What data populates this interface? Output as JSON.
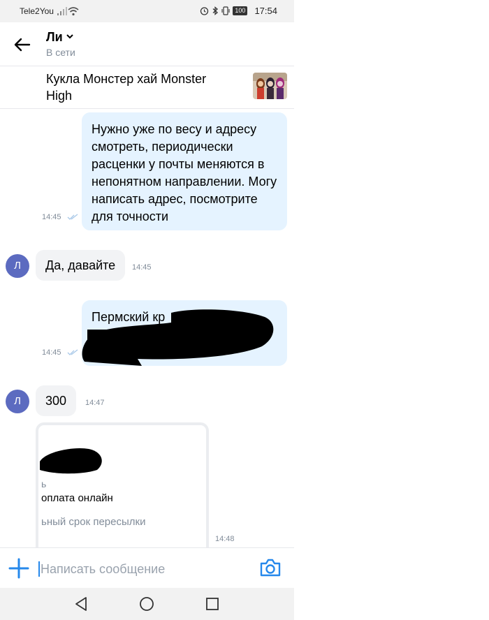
{
  "status_bar": {
    "carrier": "Tele2You",
    "battery": "100",
    "time": "17:54"
  },
  "header": {
    "contact_name": "Ли",
    "status": "В сети"
  },
  "product": {
    "title": "Кукла Монстер хай Monster High"
  },
  "messages": [
    {
      "direction": "out",
      "text": "Нужно уже по весу и адресу смотреть, периодически расценки у почты меняются в непонятном направлении. Могу написать адрес, посмотрите для точности",
      "time": "14:45"
    },
    {
      "direction": "in",
      "avatar": "Л",
      "text": "Да, давайте",
      "time": "14:45"
    },
    {
      "direction": "out",
      "text": "Пермский кр",
      "time": "14:45"
    },
    {
      "direction": "in",
      "avatar": "Л",
      "text": "300",
      "time": "14:47"
    },
    {
      "direction": "in",
      "type": "card",
      "lines": [
        "ь",
        "оплата онлайн",
        "ьный срок пересылки"
      ],
      "time": "14:48"
    }
  ],
  "composer": {
    "placeholder": "Написать сообщение"
  },
  "colors": {
    "accent": "#2688eb",
    "outgoing_bubble": "#e5f3ff",
    "incoming_bubble": "#f2f3f5",
    "avatar": "#5c6bc0"
  }
}
